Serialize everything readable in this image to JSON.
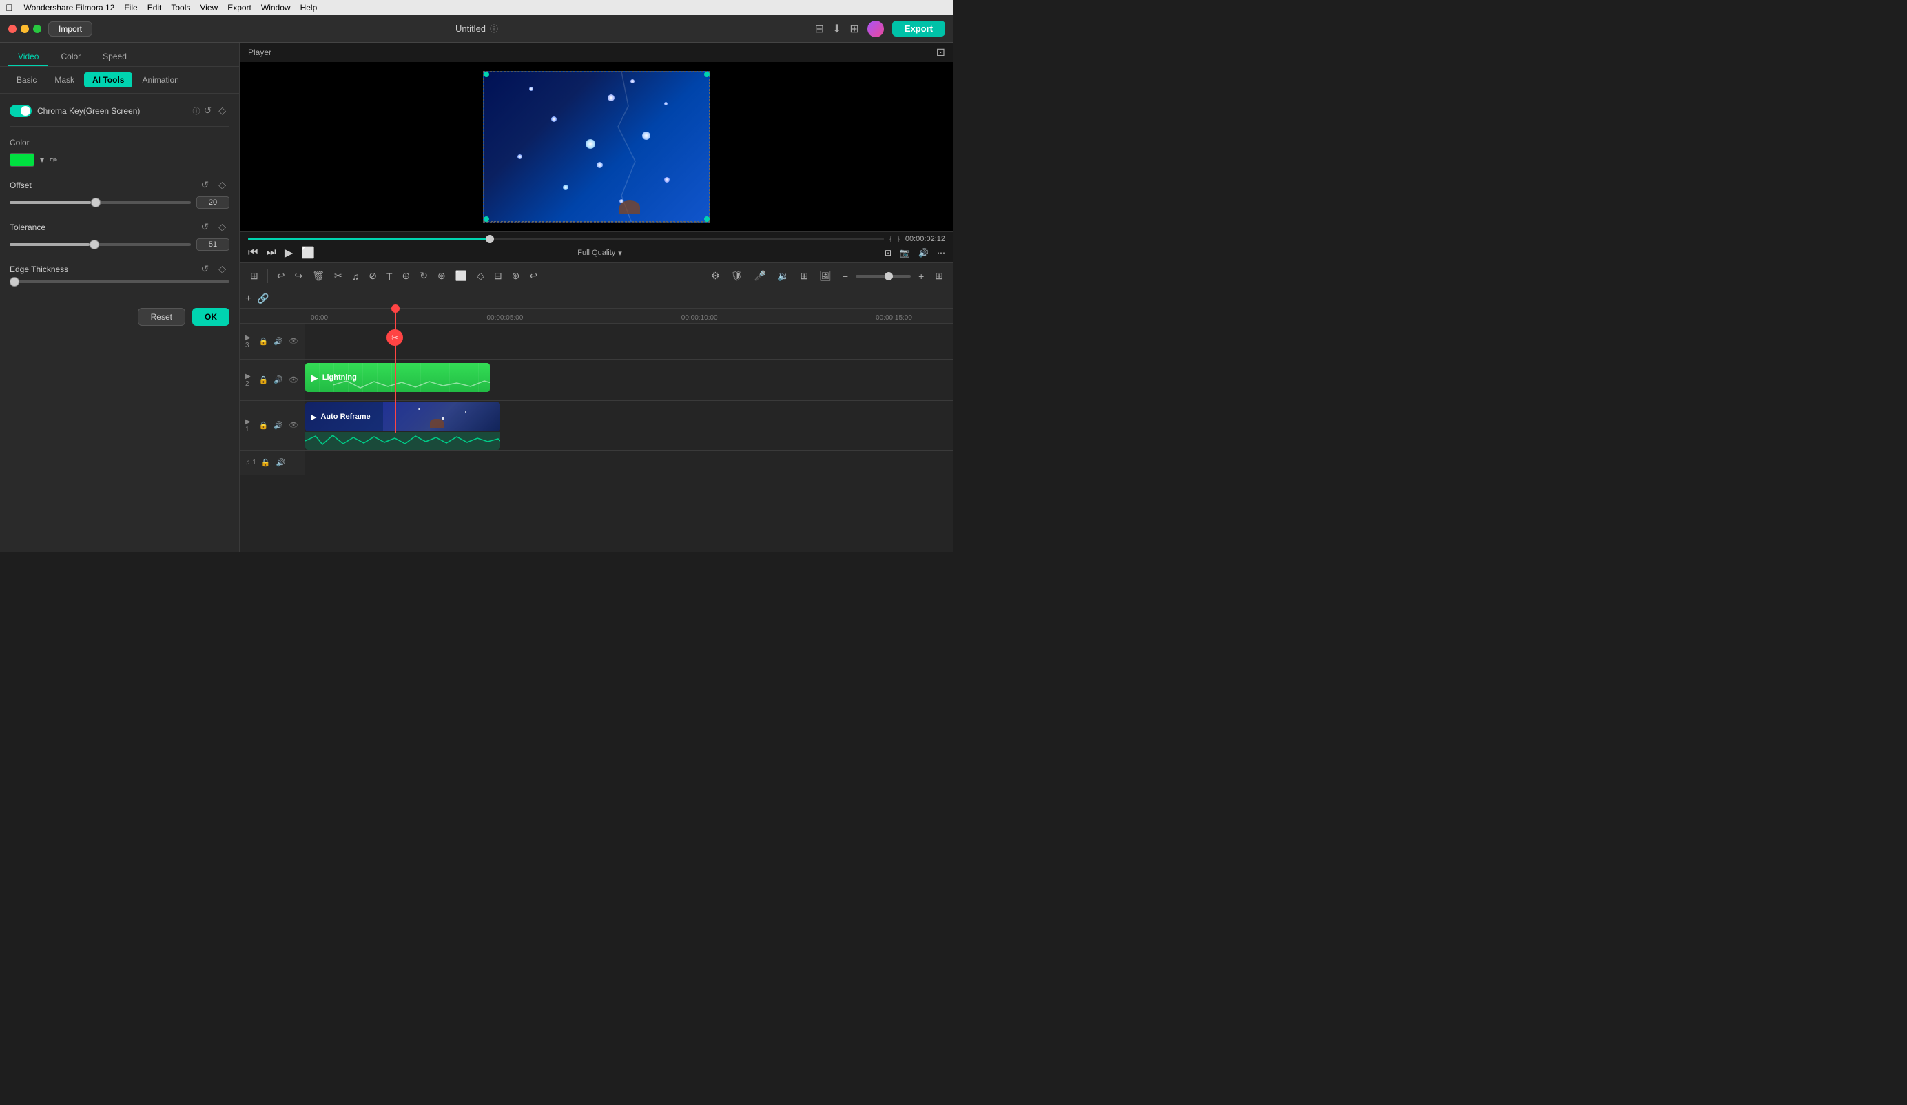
{
  "app": {
    "name": "Wondershare Filmora 12",
    "title": "Untitled"
  },
  "menu": {
    "apple": "",
    "items": [
      "Wondershare Filmora 12",
      "File",
      "Edit",
      "Tools",
      "View",
      "Export",
      "Window",
      "Help"
    ]
  },
  "titlebar": {
    "import_label": "Import",
    "title": "Untitled",
    "export_label": "Export"
  },
  "left_panel": {
    "tabs": [
      "Video",
      "Color",
      "Speed"
    ],
    "active_tab": "Video",
    "sub_tabs": [
      "Basic",
      "Mask",
      "AI Tools",
      "Animation"
    ],
    "active_sub_tab": "AI Tools",
    "chroma_key": {
      "label": "Chroma Key(Green Screen)",
      "enabled": true
    },
    "color_section": {
      "label": "Color",
      "swatch": "#00e040"
    },
    "offset": {
      "label": "Offset",
      "value": 20,
      "percent": 45
    },
    "tolerance": {
      "label": "Tolerance",
      "value": 51,
      "percent": 45
    },
    "edge_thickness": {
      "label": "Edge Thickness"
    },
    "reset_label": "Reset",
    "ok_label": "OK"
  },
  "player": {
    "label": "Player",
    "time": "00:00:02:12",
    "quality": "Full Quality",
    "playback_percent": 38
  },
  "toolbar": {
    "icons": [
      "⊞",
      "↩",
      "↪",
      "🗑",
      "✂",
      "♪",
      "⊘",
      "T",
      "⊕",
      "↻",
      "⊛",
      "⬜",
      "⊞",
      "◇",
      "⊟",
      "⊛",
      "↩"
    ]
  },
  "timeline": {
    "markers": [
      "00:00",
      "00:00:05:00",
      "00:00:10:00",
      "00:00:15:00"
    ],
    "tracks": [
      {
        "id": "track3",
        "label": "▶ 3",
        "type": "video"
      },
      {
        "id": "track2",
        "label": "▶ 2",
        "type": "video",
        "clip": {
          "name": "Lightning",
          "color": "#33dd55"
        }
      },
      {
        "id": "track1",
        "label": "▶ 1",
        "type": "video",
        "clip": {
          "name": "Auto Reframe",
          "color": "#1a3a7a"
        }
      }
    ],
    "music_track": {
      "label": "♫ 1"
    }
  }
}
